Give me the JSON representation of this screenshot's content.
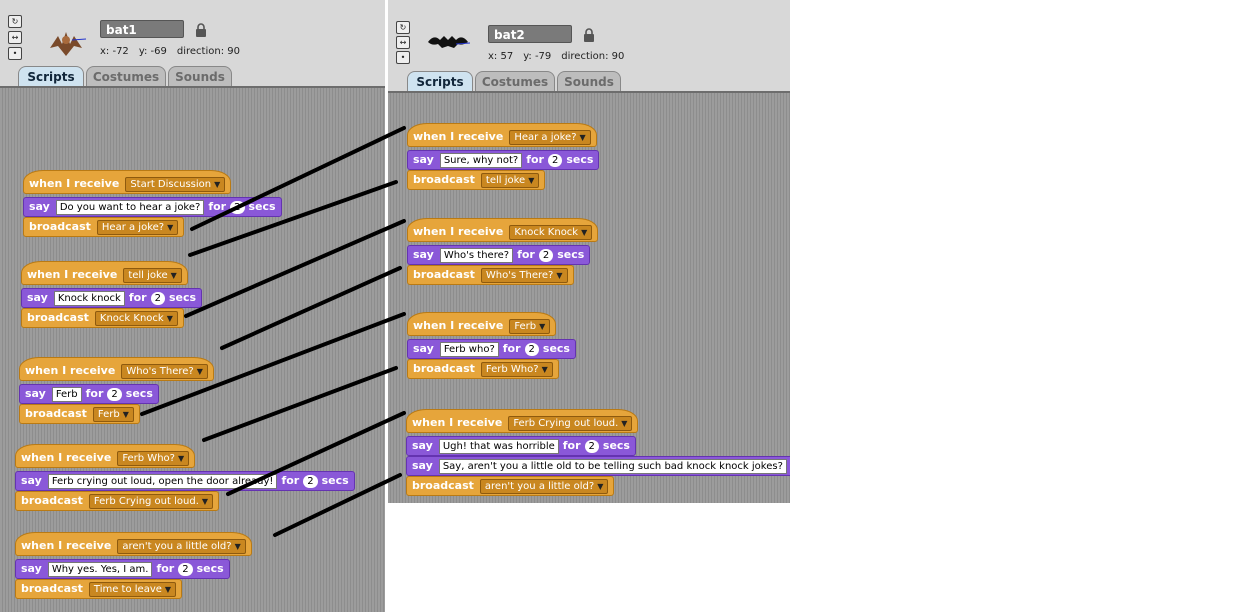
{
  "bat1": {
    "name": "bat1",
    "x": "x: -72",
    "y": "y: -69",
    "direction": "direction: 90",
    "tabs": [
      "Scripts",
      "Costumes",
      "Sounds"
    ],
    "scripts": [
      {
        "event": "when I receive",
        "message": "Start Discussion",
        "say_label": "say",
        "say_text": "Do you want to hear a joke?",
        "for_label": "for",
        "secs_value": "2",
        "secs_label": "secs",
        "broadcast_label": "broadcast",
        "broadcast_msg": "Hear a joke?"
      },
      {
        "event": "when I receive",
        "message": "tell joke",
        "say_label": "say",
        "say_text": "Knock knock",
        "for_label": "for",
        "secs_value": "2",
        "secs_label": "secs",
        "broadcast_label": "broadcast",
        "broadcast_msg": "Knock Knock"
      },
      {
        "event": "when I receive",
        "message": "Who's There?",
        "say_label": "say",
        "say_text": "Ferb",
        "for_label": "for",
        "secs_value": "2",
        "secs_label": "secs",
        "broadcast_label": "broadcast",
        "broadcast_msg": "Ferb"
      },
      {
        "event": "when I receive",
        "message": "Ferb Who?",
        "say_label": "say",
        "say_text": "Ferb crying out loud, open the door already!",
        "for_label": "for",
        "secs_value": "2",
        "secs_label": "secs",
        "broadcast_label": "broadcast",
        "broadcast_msg": "Ferb Crying out loud."
      },
      {
        "event": "when I receive",
        "message": "aren't you a little old?",
        "say_label": "say",
        "say_text": "Why yes. Yes, I am.",
        "for_label": "for",
        "secs_value": "2",
        "secs_label": "secs",
        "broadcast_label": "broadcast",
        "broadcast_msg": "Time to leave"
      }
    ]
  },
  "bat2": {
    "name": "bat2",
    "x": "x: 57",
    "y": "y: -79",
    "direction": "direction: 90",
    "tabs": [
      "Scripts",
      "Costumes",
      "Sounds"
    ],
    "scripts": [
      {
        "event": "when I receive",
        "message": "Hear a joke?",
        "say_label": "say",
        "say_text": "Sure, why not?",
        "for_label": "for",
        "secs_value": "2",
        "secs_label": "secs",
        "broadcast_label": "broadcast",
        "broadcast_msg": "tell joke"
      },
      {
        "event": "when I receive",
        "message": "Knock Knock",
        "say_label": "say",
        "say_text": "Who's there?",
        "for_label": "for",
        "secs_value": "2",
        "secs_label": "secs",
        "broadcast_label": "broadcast",
        "broadcast_msg": "Who's There?"
      },
      {
        "event": "when I receive",
        "message": "Ferb",
        "say_label": "say",
        "say_text": "Ferb who?",
        "for_label": "for",
        "secs_value": "2",
        "secs_label": "secs",
        "broadcast_label": "broadcast",
        "broadcast_msg": "Ferb Who?"
      },
      {
        "event": "when I receive",
        "message": "Ferb Crying out loud.",
        "say_label": "say",
        "say_text": "Ugh! that was horrible",
        "for_label": "for",
        "secs_value": "2",
        "secs_label": "secs",
        "say2_label": "say",
        "say2_text": "Say, aren't you a little old to be telling such bad knock knock jokes?",
        "broadcast_label": "broadcast",
        "broadcast_msg": "aren't you a little old?"
      }
    ]
  },
  "colors": {
    "event_block": "#e6a53b",
    "looks_block": "#8a58d8",
    "script_area": "#9a9a9a",
    "active_tab": "#cfe3f0",
    "connector_line": "#000000"
  },
  "icons": [
    "rotate-icon",
    "flip-icon",
    "no-rotate-icon",
    "bat-sprite-icon",
    "lock-icon",
    "dropdown-arrow-icon"
  ]
}
